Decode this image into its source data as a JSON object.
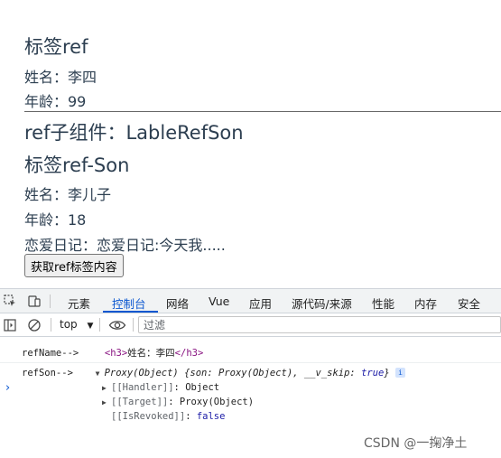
{
  "page": {
    "heading_1": "标签ref",
    "line_name": "姓名：李四",
    "line_age": "年龄：99",
    "heading_2": "ref子组件：LableRefSon",
    "heading_3": "标签ref-Son",
    "son_name": "姓名：李儿子",
    "son_age": "年龄：18",
    "son_diary": "恋爱日记：恋爱日记:今天我.....",
    "get_button": "获取ref标签内容"
  },
  "devtools": {
    "tabs": [
      "元素",
      "控制台",
      "网络",
      "Vue",
      "应用",
      "源代码/来源",
      "性能",
      "内存",
      "安全"
    ],
    "active_tab": "控制台",
    "context": "top",
    "filter_placeholder": "过滤",
    "accent_color": "#0b57d0",
    "console": {
      "line1_label": "refName-->",
      "line1_open_tag": "<h3>",
      "line1_text": "姓名：李四",
      "line1_close_tag": "</h3>",
      "line2_label": "refSon-->",
      "line2_proxy": "Proxy(Object)",
      "line2_preview_open": "{son: ",
      "line2_preview_mid": "Proxy(Object), __v_skip: ",
      "line2_preview_val": "true",
      "line2_preview_close": "}",
      "info_badge": "i",
      "prop_handler_key": "[[Handler]]",
      "prop_handler_val": "Object",
      "prop_target_key": "[[Target]]",
      "prop_target_val": "Proxy(Object)",
      "prop_revoked_key": "[[IsRevoked]]",
      "prop_revoked_val": "false"
    }
  },
  "watermark": "CSDN @一掬净土"
}
